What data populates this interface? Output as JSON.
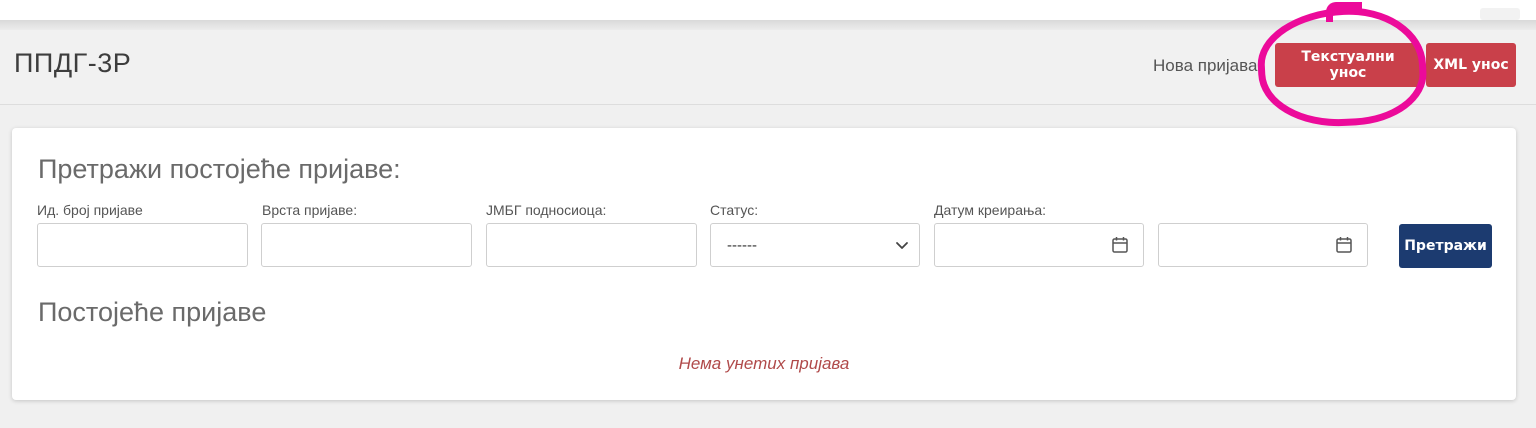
{
  "header": {
    "title": "ППДГ-3Р",
    "new_application_label": "Нова пријава:",
    "text_entry_button": "Текстуални унос",
    "xml_entry_button": "XML унос"
  },
  "search": {
    "title": "Претражи постојеће пријаве:",
    "fields": {
      "id_label": "Ид. број пријаве",
      "type_label": "Врста пријаве:",
      "jmbg_label": "ЈМБГ подносиоца:",
      "status_label": "Статус:",
      "status_value": "------",
      "date_label": "Датум креирања:"
    },
    "button": "Претражи"
  },
  "results": {
    "title": "Постојеће пријаве",
    "empty_message": "Нема унетих пријава"
  },
  "colors": {
    "primary_red": "#c9404a",
    "navy": "#1c3b70",
    "highlight": "#ec0a9a",
    "empty_text": "#b04a4a"
  },
  "icons": [
    "chevron-down-icon",
    "calendar-icon"
  ]
}
